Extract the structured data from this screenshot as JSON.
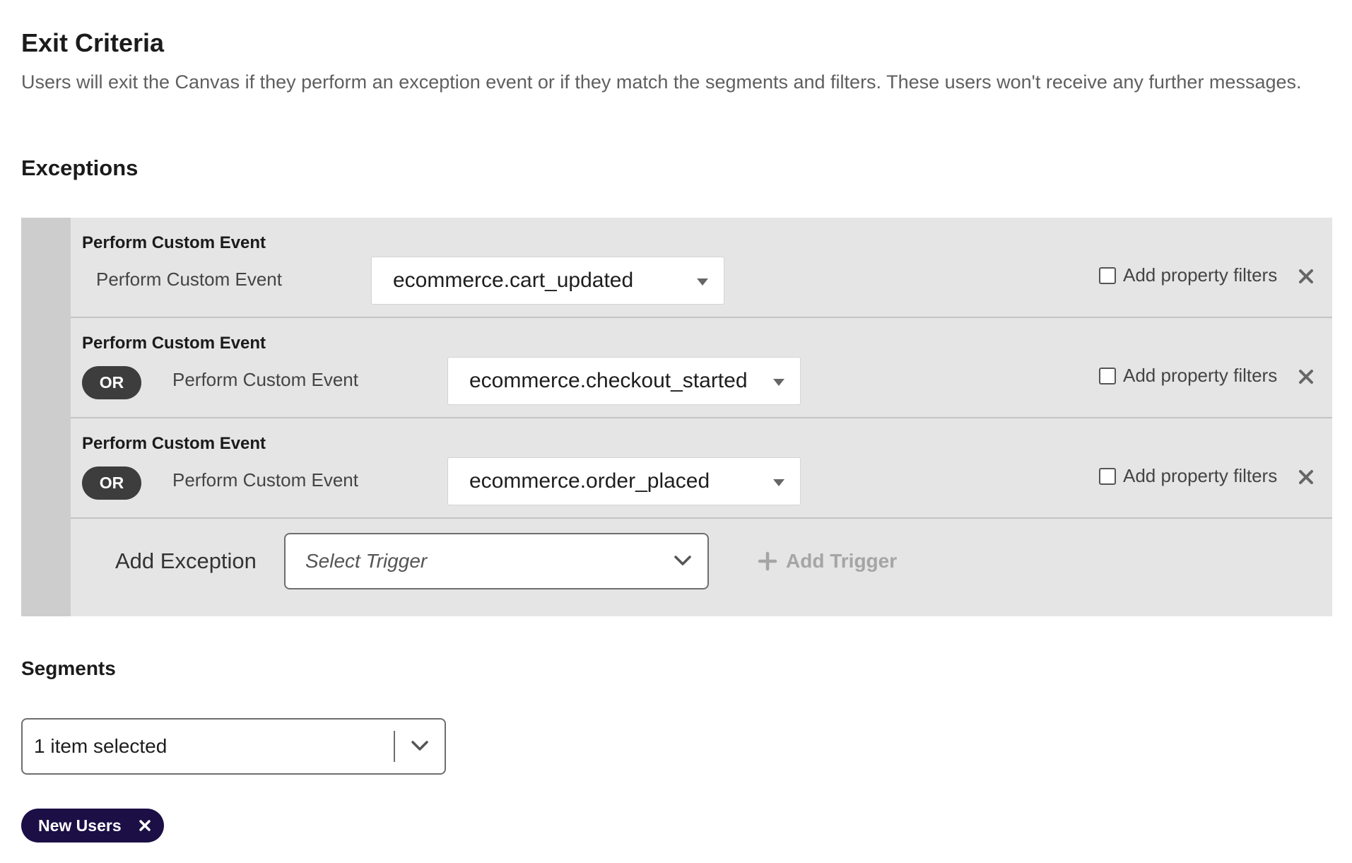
{
  "header": {
    "title": "Exit Criteria",
    "description": "Users will exit the Canvas if they perform an exception event or if they match the segments and filters. These users won't receive any further messages."
  },
  "exceptions": {
    "section_title": "Exceptions",
    "rows": [
      {
        "label": "Perform Custom Event",
        "operator": "",
        "event_type": "Perform Custom Event",
        "event_value": "ecommerce.cart_updated",
        "property_filter_label": "Add property filters"
      },
      {
        "label": "Perform Custom Event",
        "operator": "OR",
        "event_type": "Perform Custom Event",
        "event_value": "ecommerce.checkout_started",
        "property_filter_label": "Add property filters"
      },
      {
        "label": "Perform Custom Event",
        "operator": "OR",
        "event_type": "Perform Custom Event",
        "event_value": "ecommerce.order_placed",
        "property_filter_label": "Add property filters"
      }
    ],
    "add_exception_label": "Add Exception",
    "trigger_placeholder": "Select Trigger",
    "add_trigger_label": "Add Trigger"
  },
  "segments": {
    "section_title": "Segments",
    "selected_value": "1 item selected",
    "tags": [
      "New Users"
    ]
  },
  "icons": {
    "caret": "caret-down-icon",
    "chevron": "chevron-down-icon",
    "close": "close-icon",
    "plus": "plus-icon"
  },
  "colors": {
    "panel_background": "#e5e5e5",
    "panel_bar": "#cdcdcd",
    "or_pill": "#3d3d3d",
    "tag_background": "#1b0f46",
    "disabled_text": "#a5a5a5"
  }
}
